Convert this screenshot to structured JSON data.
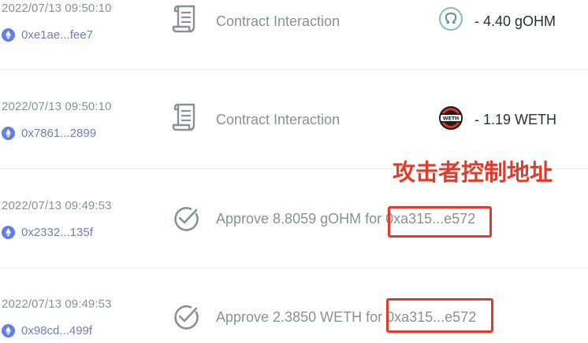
{
  "transactions": [
    {
      "timestamp": "2022/07/13 09:50:10",
      "address": "0xe1ae...fee7",
      "action_icon": "contract-scroll-icon",
      "action": "Contract Interaction",
      "token_icon": "gohm-icon",
      "amount": "- 4.40 gOHM"
    },
    {
      "timestamp": "2022/07/13 09:50:10",
      "address": "0x7861...2899",
      "action_icon": "contract-scroll-icon",
      "action": "Contract Interaction",
      "token_icon": "weth-icon",
      "token_label": "WETH",
      "amount": "- 1.19 WETH"
    },
    {
      "timestamp": "2022/07/13 09:49:53",
      "address": "0x2332...135f",
      "action_icon": "approve-check-icon",
      "action": "Approve 8.8059 gOHM for ",
      "spender": "0xa315...e572"
    },
    {
      "timestamp": "2022/07/13 09:49:53",
      "address": "0x98cd...499f",
      "action_icon": "approve-check-icon",
      "action": "Approve 2.3850 WETH for ",
      "spender": "0xa315...e572"
    }
  ],
  "annotation": "攻击者控制地址",
  "colors": {
    "annotation_red": "#e53a2a",
    "address_blue": "#6e7fb0",
    "eth_icon_blue": "#627eea",
    "muted_text": "#8b8f96",
    "amount_text": "#2b2f36"
  }
}
